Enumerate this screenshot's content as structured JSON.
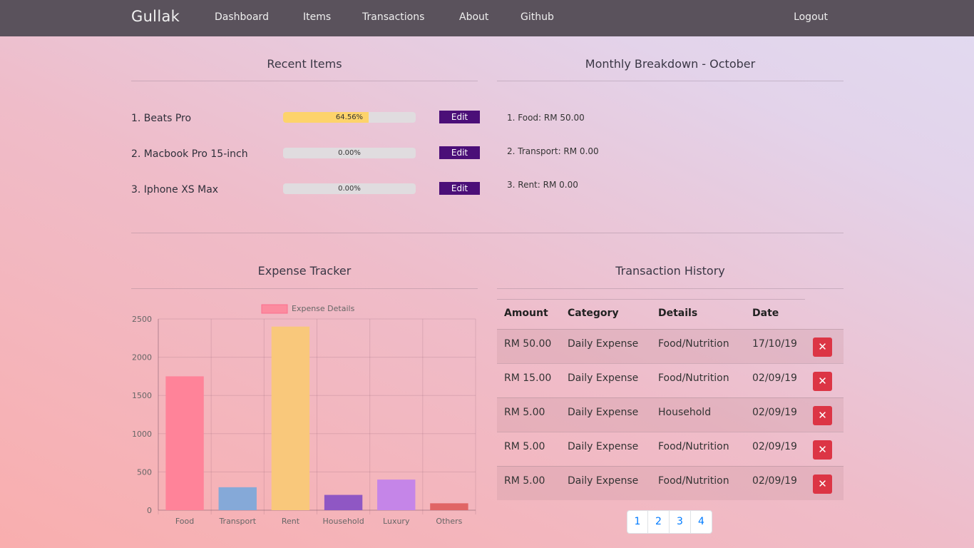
{
  "nav": {
    "brand": "Gullak",
    "links": [
      "Dashboard",
      "Items",
      "Transactions",
      "About",
      "Github"
    ],
    "logout": "Logout"
  },
  "recent_items": {
    "title": "Recent Items",
    "items": [
      {
        "name": "1. Beats Pro",
        "progress": 64.56,
        "progress_label": "64.56%",
        "action": "Edit"
      },
      {
        "name": "2. Macbook Pro 15-inch",
        "progress": 0,
        "progress_label": "0.00%",
        "action": "Edit"
      },
      {
        "name": "3. Iphone XS Max",
        "progress": 0,
        "progress_label": "0.00%",
        "action": "Edit"
      }
    ]
  },
  "monthly_breakdown": {
    "title": "Monthly Breakdown - October",
    "items": [
      "1. Food: RM 50.00",
      "2. Transport: RM 0.00",
      "3. Rent: RM 0.00"
    ]
  },
  "expense_tracker": {
    "title": "Expense Tracker"
  },
  "chart_data": {
    "type": "bar",
    "categories": [
      "Food",
      "Transport",
      "Rent",
      "Household",
      "Luxury",
      "Others"
    ],
    "series": [
      {
        "name": "Expense Details",
        "values": [
          1750,
          300,
          2400,
          200,
          400,
          90
        ]
      }
    ],
    "colors": [
      "#ff8399",
      "#85a9d8",
      "#f9c87b",
      "#8f57c4",
      "#c585e8",
      "#e06565"
    ],
    "yticks": [
      0,
      500,
      1000,
      1500,
      2000,
      2500
    ],
    "ylim": [
      0,
      2500
    ],
    "grid": true,
    "legend": "top-center"
  },
  "transaction_history": {
    "title": "Transaction History",
    "headers": [
      "Amount",
      "Category",
      "Details",
      "Date"
    ],
    "rows": [
      {
        "amount": "RM 50.00",
        "category": "Daily Expense",
        "details": "Food/Nutrition",
        "date": "17/10/19"
      },
      {
        "amount": "RM 15.00",
        "category": "Daily Expense",
        "details": "Food/Nutrition",
        "date": "02/09/19"
      },
      {
        "amount": "RM 5.00",
        "category": "Daily Expense",
        "details": "Household",
        "date": "02/09/19"
      },
      {
        "amount": "RM 5.00",
        "category": "Daily Expense",
        "details": "Food/Nutrition",
        "date": "02/09/19"
      },
      {
        "amount": "RM 5.00",
        "category": "Daily Expense",
        "details": "Food/Nutrition",
        "date": "02/09/19"
      }
    ],
    "delete_icon": "close-icon",
    "pages": [
      "1",
      "2",
      "3",
      "4"
    ]
  }
}
